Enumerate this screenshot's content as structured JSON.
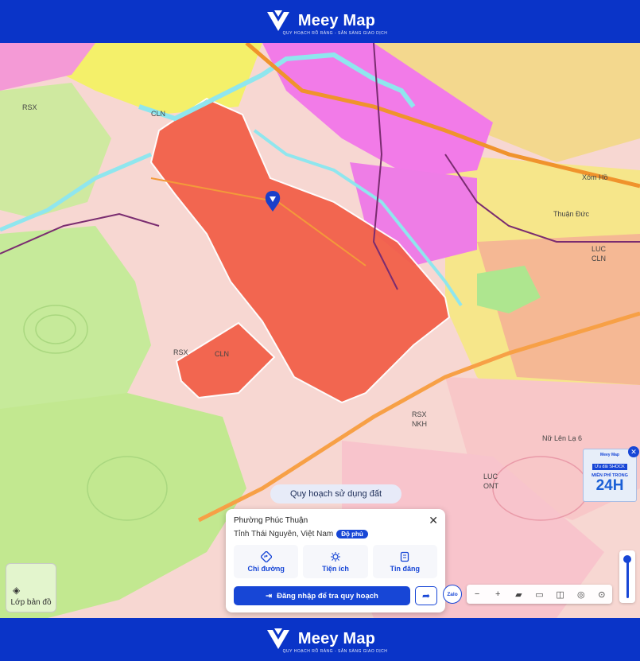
{
  "header": {
    "brand": "Meey Map",
    "tagline": "QUY HOẠCH RÕ RÀNG - SẴN SÀNG GIAO DỊCH"
  },
  "footer": {
    "brand": "Meey Map",
    "tagline": "QUY HOẠCH RÕ RÀNG - SẴN SÀNG GIAO DỊCH"
  },
  "map": {
    "labels": [
      "RSX",
      "CLN",
      "RSX",
      "CLN",
      "RSX",
      "NKH",
      "LUC",
      "ONT",
      "LUC",
      "CLN",
      "Xóm Hồ",
      "Thuận Đức",
      "Nữ Lên Lạ 6"
    ],
    "layer_button": "Lớp bản đồ",
    "mode_pill": "Quy hoạch sử dụng đất",
    "zalo": "Zalo",
    "toolbar_icons": [
      "minus-icon",
      "plus-icon",
      "brush-icon",
      "ruler-icon",
      "split-icon",
      "globe-icon",
      "locate-icon"
    ]
  },
  "panel": {
    "ward": "Phường Phúc Thuận",
    "province": "Tỉnh Thái Nguyên, Việt Nam",
    "badge": "Độ phủ",
    "actions": [
      {
        "label": "Chỉ đường",
        "icon": "directions-icon"
      },
      {
        "label": "Tiện ích",
        "icon": "utilities-icon"
      },
      {
        "label": "Tin đăng",
        "icon": "listings-icon"
      }
    ],
    "login_label": "Đăng nhập để tra quy hoạch"
  },
  "promo": {
    "brand": "Meey Map",
    "hot": "Ưu đãi SHOCK",
    "free": "MIỄN PHÍ TRONG",
    "hours": "24H"
  },
  "colors": {
    "brand_blue": "#0a34c8",
    "accent": "#1746d6",
    "planning_red": "#f2604a"
  }
}
